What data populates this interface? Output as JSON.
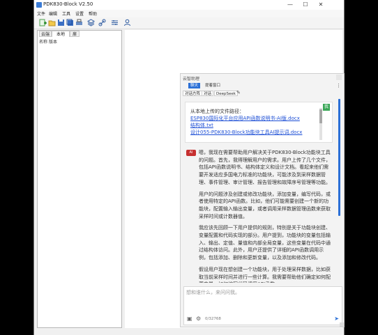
{
  "window": {
    "title": "PDK830-Block V2.50",
    "min": "—",
    "max": "☐",
    "close": "✕"
  },
  "menu": [
    "文件",
    "编辑",
    "工具",
    "设置",
    "帮助"
  ],
  "toolbar": {
    "icons": [
      "new-icon",
      "open-icon",
      "save-icon",
      "save-all-icon",
      "print-icon",
      "layers-icon",
      "link-icon",
      "settings-icon",
      "user-icon"
    ]
  },
  "left": {
    "tabs": [
      "云端",
      "本地",
      "扉"
    ],
    "headers": [
      "名称",
      "版本"
    ]
  },
  "chat": {
    "title": "云智助理",
    "tabs": [
      "聊天",
      "提着窗口"
    ],
    "subtabs": [
      "对话方阵",
      "对话",
      "DeepSeek"
    ],
    "kebab": "⋮",
    "pencil": "✎",
    "user_msg": {
      "header": "从本地上传的文件路径：",
      "links": [
        "ESP830国际化平台应用API函数说明书-AI版.docx",
        "结构体.txt",
        "设计055-PDK830-Block功能块工具AI提示词.docx"
      ],
      "button": "我"
    },
    "bot_avatar": "AI",
    "bot_paragraphs": [
      "嗯，我现在需要帮助用户解决关于PDK830-Block功能块工具的问题。首先，我得理解用户的需求。用户上传了几个文件，包括API函数说明书、结构体定义和设计文档。看起来他们需要开发适应多国电力标准的功能块，可能涉及到采样数据管理、事件管理、审计管理、报告管理和故障序号管理等功能。",
      "用户的问题涉及创建或修改功能块，添加变量，编写代码，或者使用特定的API函数。比如，他们可能需要创建一个新的功能块，配置输入输出变量，或者调用采样数据管理函数来获取采样时间或计数器值。",
      "我应该先回顾一下用户提供的规则，特别是关于功能块创建、变量配置和代码实现的部分。用户提到，功能块的变量包括输入、输出、定值、量值和内部全局变量，这些变量在代码中通过结构体访问。此外，用户还提供了详细的API函数调用示例，包括添加、删除和更新变量，以及添加和修改代码。",
      "假设用户现在想创建一个功能块，用于处理采样数据，比如获取当前采样时间并进行一些计算。我需要帮助他们确定如何配置变量，如何编写代码调用API函数。"
    ],
    "input_placeholder": "想和谁什么，来问问我。",
    "counter": "0/32768",
    "send": "➤"
  }
}
